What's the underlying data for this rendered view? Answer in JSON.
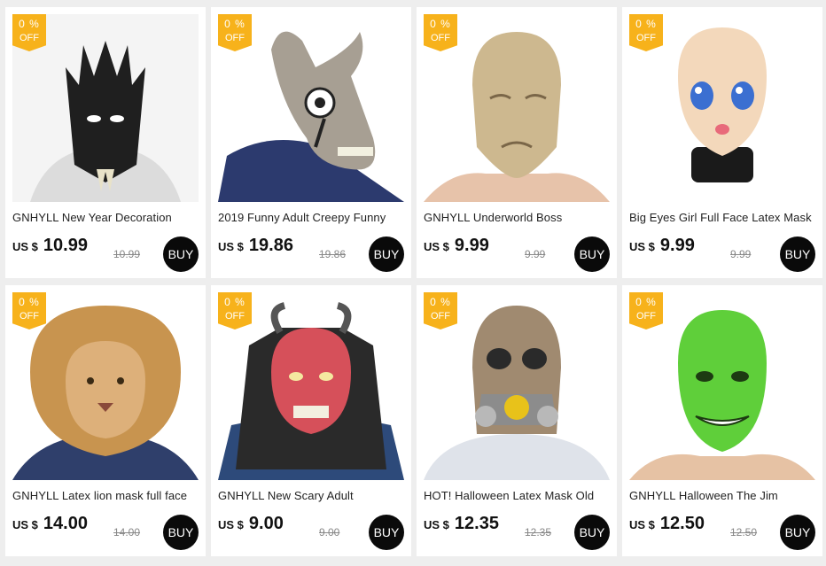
{
  "products": [
    {
      "badge_top": "0 %",
      "badge_bottom": "OFF",
      "title": "GNHYLL New Year Decoration",
      "currency": "US $",
      "price": "10.99",
      "old_price": "10.99",
      "buy_label": "BUY",
      "image_icon": "dragon-mask-icon",
      "bg": "#dedede",
      "main": "#1e1e1e"
    },
    {
      "badge_top": "0 %",
      "badge_bottom": "OFF",
      "title": "2019 Funny Adult Creepy Funny",
      "currency": "US $",
      "price": "19.86",
      "old_price": "19.86",
      "buy_label": "BUY",
      "image_icon": "donkey-mask-icon",
      "bg": "#ffffff",
      "main": "#a59a8c"
    },
    {
      "badge_top": "0 %",
      "badge_bottom": "OFF",
      "title": "GNHYLL Underworld Boss",
      "currency": "US $",
      "price": "9.99",
      "old_price": "9.99",
      "buy_label": "BUY",
      "image_icon": "old-man-mask-icon",
      "bg": "#ffffff",
      "main": "#c9b58f"
    },
    {
      "badge_top": "0 %",
      "badge_bottom": "OFF",
      "title": "Big Eyes Girl Full Face Latex Mask",
      "currency": "US $",
      "price": "9.99",
      "old_price": "9.99",
      "buy_label": "BUY",
      "image_icon": "anime-girl-mask-icon",
      "bg": "#ffffff",
      "main": "#f2d7b8"
    },
    {
      "badge_top": "0 %",
      "badge_bottom": "OFF",
      "title": "GNHYLL Latex lion mask  full face",
      "currency": "US $",
      "price": "14.00",
      "old_price": "14.00",
      "buy_label": "BUY",
      "image_icon": "lion-mask-icon",
      "bg": "#ffffff",
      "main": "#c8944f"
    },
    {
      "badge_top": "0 %",
      "badge_bottom": "OFF",
      "title": "GNHYLL New Scary Adult",
      "currency": "US $",
      "price": "9.00",
      "old_price": "9.00",
      "buy_label": "BUY",
      "image_icon": "devil-mask-icon",
      "bg": "#ffffff",
      "main": "#d6505a"
    },
    {
      "badge_top": "0 %",
      "badge_bottom": "OFF",
      "title": "HOT! Halloween Latex Mask Old",
      "currency": "US $",
      "price": "12.35",
      "old_price": "12.35",
      "buy_label": "BUY",
      "image_icon": "gas-mask-skull-icon",
      "bg": "#ffffff",
      "main": "#a08a70"
    },
    {
      "badge_top": "0 %",
      "badge_bottom": "OFF",
      "title": "GNHYLL Halloween The Jim",
      "currency": "US $",
      "price": "12.50",
      "old_price": "12.50",
      "buy_label": "BUY",
      "image_icon": "green-face-mask-icon",
      "bg": "#ffffff",
      "main": "#5fcf3a"
    }
  ]
}
